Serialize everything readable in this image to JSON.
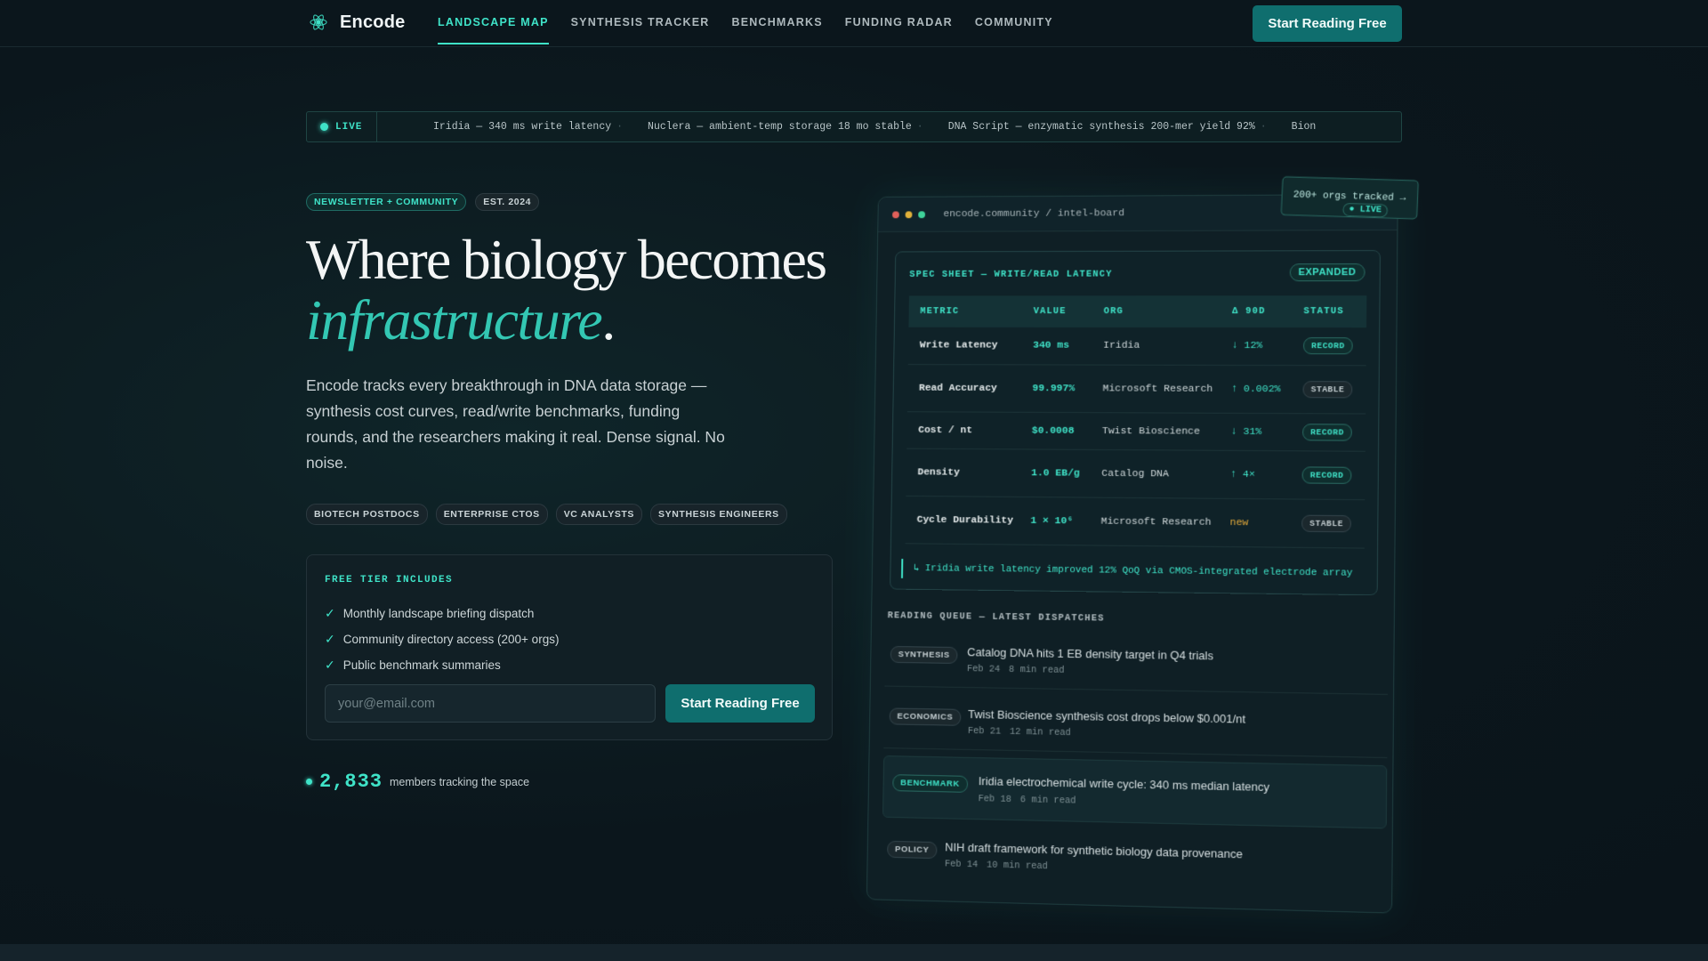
{
  "nav": {
    "brand": "Encode",
    "links": [
      "LANDSCAPE MAP",
      "SYNTHESIS TRACKER",
      "BENCHMARKS",
      "FUNDING RADAR",
      "COMMUNITY"
    ],
    "cta": "Start Reading Free"
  },
  "ticker": {
    "live": "LIVE",
    "items": [
      "Iridia — 340 ms write latency",
      "Nuclera — ambient-temp storage 18 mo stable",
      "DNA Script — enzymatic synthesis 200-mer yield 92%",
      "Bion"
    ],
    "sep": "·"
  },
  "hero": {
    "tag_primary": "NEWSLETTER + COMMUNITY",
    "tag_secondary": "EST. 2024",
    "headline_1": "Where biology becomes",
    "headline_2": "infrastructure",
    "headline_dot": ".",
    "lede": "Encode tracks every breakthrough in DNA data storage — synthesis cost curves, read/write benchmarks, funding rounds, and the researchers making it real. Dense signal. No noise.",
    "audiences": [
      "BIOTECH POSTDOCS",
      "ENTERPRISE CTOS",
      "VC ANALYSTS",
      "SYNTHESIS ENGINEERS"
    ]
  },
  "free_tier": {
    "title": "FREE TIER INCLUDES",
    "items": [
      "Monthly landscape briefing dispatch",
      "Community directory access (200+ orgs)",
      "Public benchmark summaries"
    ],
    "check": "✓",
    "email_placeholder": "your@email.com",
    "cta": "Start Reading Free"
  },
  "members": {
    "count": "2,833",
    "label": "members tracking the space"
  },
  "panel": {
    "url": "encode.community / intel-board",
    "float_text": "200+ orgs tracked →",
    "float_live": "● LIVE",
    "spec_title": "SPEC SHEET — WRITE/READ LATENCY",
    "expanded": "EXPANDED",
    "headers": [
      "METRIC",
      "VALUE",
      "ORG",
      "Δ 90D",
      "STATUS"
    ],
    "rows": [
      {
        "metric": "Write Latency",
        "value": "340 ms",
        "org": "Iridia",
        "delta": "↓ 12%",
        "status": "RECORD",
        "kind": "record"
      },
      {
        "metric": "Read Accuracy",
        "value": "99.997%",
        "org": "Microsoft Research",
        "delta": "↑ 0.002%",
        "status": "STABLE",
        "kind": "stable"
      },
      {
        "metric": "Cost / nt",
        "value": "$0.0008",
        "org": "Twist Bioscience",
        "delta": "↓ 31%",
        "status": "RECORD",
        "kind": "record"
      },
      {
        "metric": "Density",
        "value": "1.0 EB/g",
        "org": "Catalog DNA",
        "delta": "↑ 4×",
        "status": "RECORD",
        "kind": "record"
      },
      {
        "metric": "Cycle Durability",
        "value": "1 × 10⁶",
        "org": "Microsoft Research",
        "delta": "new",
        "status": "STABLE",
        "kind": "stable"
      }
    ],
    "note": "↳ Iridia write latency improved 12% QoQ via CMOS-integrated electrode array",
    "queue_title": "READING QUEUE — LATEST DISPATCHES",
    "queue": [
      {
        "tag": "SYNTHESIS",
        "title": "Catalog DNA hits 1 EB density target in Q4 trials",
        "date": "Feb 24",
        "read": "8 min read"
      },
      {
        "tag": "ECONOMICS",
        "title": "Twist Bioscience synthesis cost drops below $0.001/nt",
        "date": "Feb 21",
        "read": "12 min read"
      },
      {
        "tag": "BENCHMARK",
        "title": "Iridia electrochemical write cycle: 340 ms median latency",
        "date": "Feb 18",
        "read": "6 min read"
      },
      {
        "tag": "POLICY",
        "title": "NIH draft framework for synthetic biology data provenance",
        "date": "Feb 14",
        "read": "10 min read"
      }
    ]
  },
  "colors": {
    "accent": "#3fe3c8",
    "cta": "#0f6e6e",
    "background": "#0b161c",
    "warn": "#e0a83a"
  }
}
